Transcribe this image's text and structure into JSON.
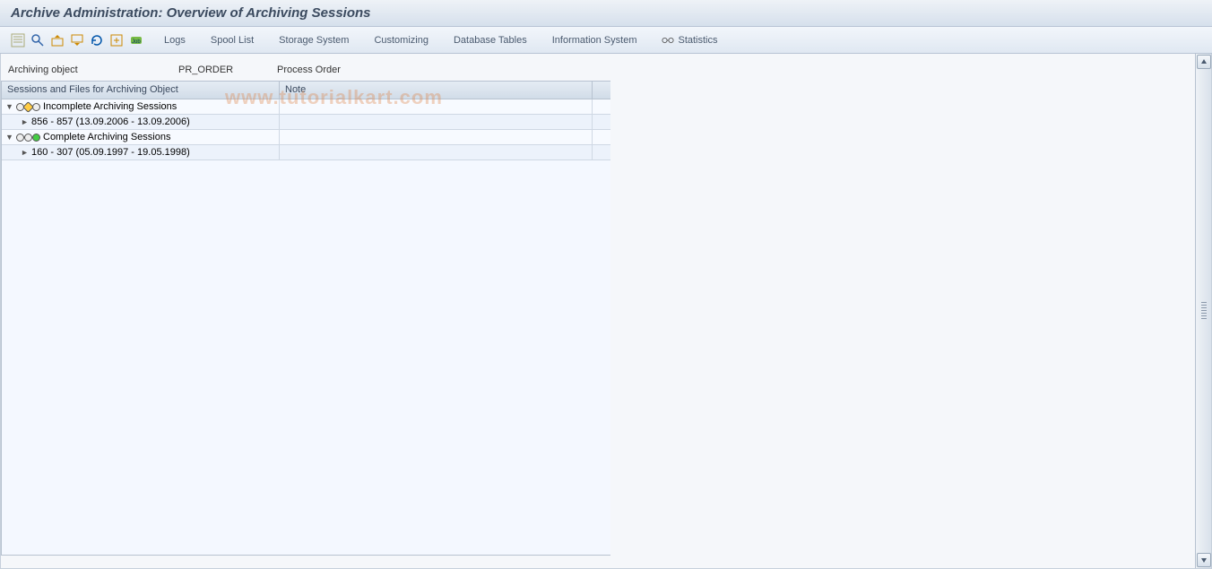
{
  "header": {
    "title": "Archive Administration: Overview of Archiving Sessions"
  },
  "toolbar": {
    "icons": [
      {
        "name": "detail-list-icon"
      },
      {
        "name": "search-icon"
      },
      {
        "name": "export-up-icon"
      },
      {
        "name": "export-down-icon"
      },
      {
        "name": "refresh-icon"
      },
      {
        "name": "execute-icon"
      },
      {
        "name": "jobs-icon"
      }
    ],
    "text_buttons": [
      {
        "name": "logs",
        "label": "Logs"
      },
      {
        "name": "spool",
        "label": "Spool List"
      },
      {
        "name": "storage",
        "label": "Storage System"
      },
      {
        "name": "custom",
        "label": "Customizing"
      },
      {
        "name": "db",
        "label": "Database Tables"
      },
      {
        "name": "info",
        "label": "Information System"
      },
      {
        "name": "stats",
        "label": "Statistics",
        "icon": "glasses-icon"
      }
    ]
  },
  "object": {
    "label": "Archiving object",
    "code": "PR_ORDER",
    "desc": "Process Order"
  },
  "tree": {
    "headers": {
      "col1": "Sessions and Files for Archiving Object",
      "col2": "Note"
    },
    "rows": [
      {
        "type": "group",
        "expanded": true,
        "status": "incomplete",
        "label": "Incomplete Archiving Sessions"
      },
      {
        "type": "leaf",
        "label": "856 - 857 (13.09.2006 - 13.09.2006)"
      },
      {
        "type": "group",
        "expanded": true,
        "status": "complete",
        "label": "Complete Archiving Sessions"
      },
      {
        "type": "leaf",
        "label": "160 - 307 (05.09.1997 - 19.05.1998)"
      }
    ]
  },
  "watermark": "www.tutorialkart.com"
}
